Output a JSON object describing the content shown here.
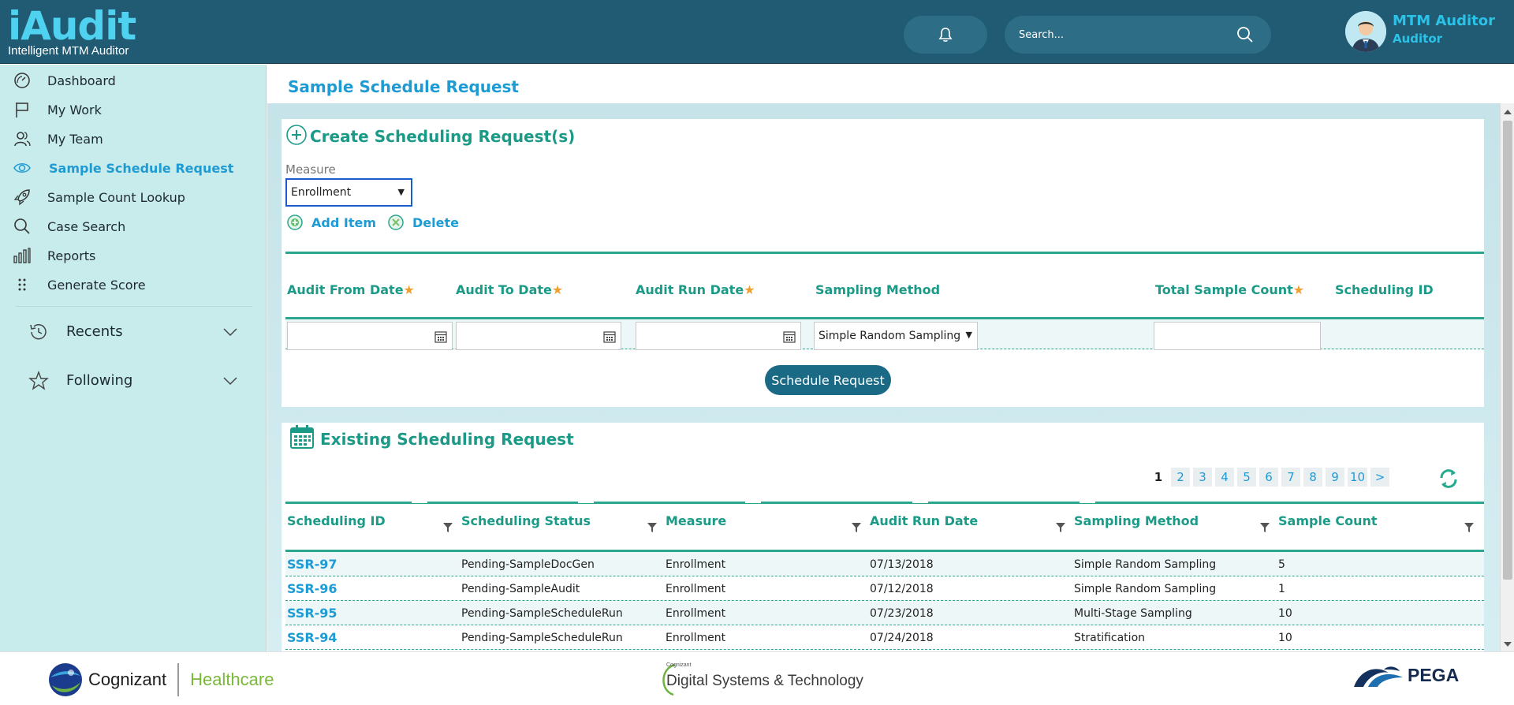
{
  "header": {
    "logo_brand": "iAudit",
    "logo_tagline": "Intelligent MTM Auditor",
    "search_placeholder": "Search...",
    "user_name": "MTM Auditor",
    "user_role": "Auditor"
  },
  "sidebar": {
    "items": [
      {
        "label": "Dashboard",
        "icon": "gauge-icon"
      },
      {
        "label": "My Work",
        "icon": "flag-icon"
      },
      {
        "label": "My Team",
        "icon": "users-icon"
      },
      {
        "label": "Sample Schedule Request",
        "icon": "eye-icon",
        "active": true
      },
      {
        "label": "Sample Count Lookup",
        "icon": "rocket-icon"
      },
      {
        "label": "Case Search",
        "icon": "search-icon"
      },
      {
        "label": "Reports",
        "icon": "bar-chart-icon"
      },
      {
        "label": "Generate Score",
        "icon": "dots-grid-icon"
      }
    ],
    "recents_label": "Recents",
    "following_label": "Following"
  },
  "page": {
    "title": "Sample Schedule Request"
  },
  "create": {
    "title": "Create Scheduling Request(s)",
    "measure_label": "Measure",
    "measure_value": "Enrollment",
    "add_item_label": "Add Item",
    "delete_label": "Delete",
    "columns": {
      "audit_from": "Audit From Date",
      "audit_to": "Audit To Date",
      "audit_run": "Audit Run Date",
      "sampling_method": "Sampling Method",
      "total_sample_count": "Total Sample Count",
      "scheduling_id": "Scheduling ID"
    },
    "required_mark": "★",
    "sampling_method_value": "Simple Random Sampling",
    "schedule_button": "Schedule Request"
  },
  "existing": {
    "title": "Existing Scheduling Request",
    "pages": [
      "1",
      "2",
      "3",
      "4",
      "5",
      "6",
      "7",
      "8",
      "9",
      "10",
      ">"
    ],
    "current_page": "1",
    "columns": [
      "Scheduling ID",
      "Scheduling Status",
      "Measure",
      "Audit Run Date",
      "Sampling Method",
      "Sample Count"
    ],
    "rows": [
      {
        "id": "SSR-97",
        "status": "Pending-SampleDocGen",
        "measure": "Enrollment",
        "run_date": "07/13/2018",
        "method": "Simple Random Sampling",
        "count": "5"
      },
      {
        "id": "SSR-96",
        "status": "Pending-SampleAudit",
        "measure": "Enrollment",
        "run_date": "07/12/2018",
        "method": "Simple Random Sampling",
        "count": "1"
      },
      {
        "id": "SSR-95",
        "status": "Pending-SampleScheduleRun",
        "measure": "Enrollment",
        "run_date": "07/23/2018",
        "method": "Multi-Stage Sampling",
        "count": "10"
      },
      {
        "id": "SSR-94",
        "status": "Pending-SampleScheduleRun",
        "measure": "Enrollment",
        "run_date": "07/24/2018",
        "method": "Stratification",
        "count": "10"
      }
    ]
  },
  "footer": {
    "cognizant": "Cognizant",
    "healthcare": "Healthcare",
    "dst_small": "Cognizant",
    "dst_text": "Digital Systems & Technology",
    "pega": "PEGA"
  },
  "colors": {
    "header_bg": "#215b73",
    "sidebar_bg": "#c8ebeb",
    "accent_blue": "#1f9bd4",
    "accent_teal": "#1b9a87",
    "required_orange": "#f0a030",
    "button_bg": "#1b6a85"
  }
}
